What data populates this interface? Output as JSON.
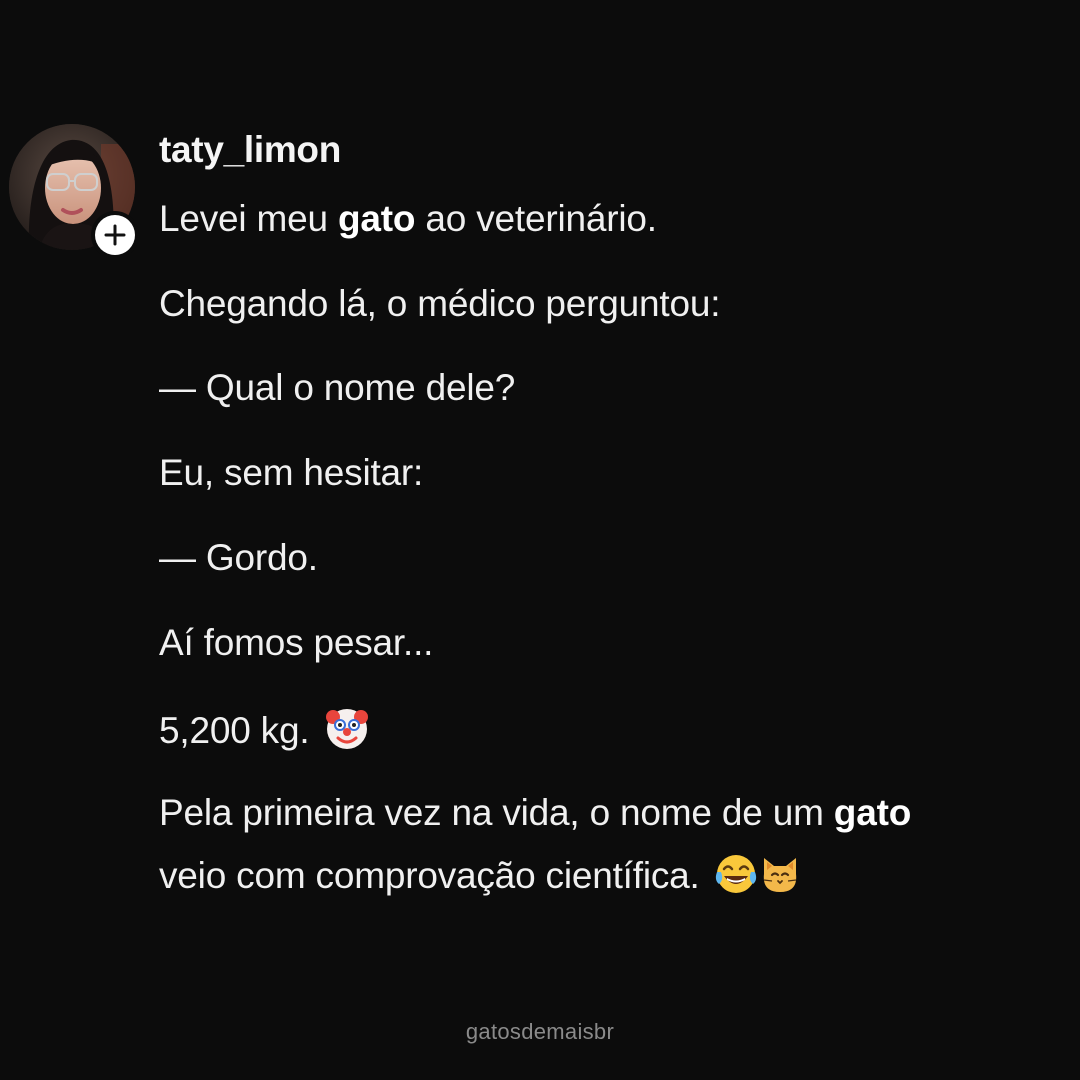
{
  "post": {
    "username": "taty_limon",
    "follow_icon": "plus-icon",
    "avatar_icon": "profile-photo",
    "lines": [
      {
        "pre": "Levei meu ",
        "bold": "gato",
        "post": " ao veterinário."
      },
      {
        "text": "Chegando lá, o médico perguntou:"
      },
      {
        "text": "— Qual o nome dele?"
      },
      {
        "text": "Eu, sem hesitar:"
      },
      {
        "text": "— Gordo."
      },
      {
        "text": "Aí fomos pesar..."
      },
      {
        "text": "5,200 kg.",
        "emoji": "clown-face-emoji"
      },
      {
        "pre": "Pela primeira vez na vida, o nome de um ",
        "bold": "gato"
      },
      {
        "text": "veio com comprovação científica.",
        "emojis": [
          "tears-of-joy-emoji",
          "cat-face-emoji"
        ]
      }
    ]
  },
  "watermark": "gatosdemaisbr"
}
